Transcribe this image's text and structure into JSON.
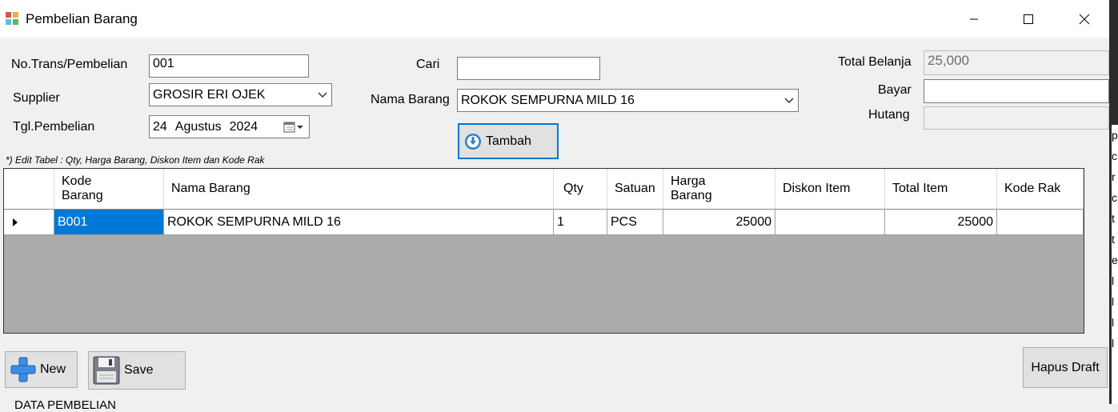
{
  "window": {
    "title": "Pembelian Barang"
  },
  "form": {
    "no_trans_label": "No.Trans/Pembelian",
    "no_trans_value": "001",
    "supplier_label": "Supplier",
    "supplier_value": "GROSIR ERI OJEK",
    "tgl_label": "Tgl.Pembelian",
    "tgl_day": "24",
    "tgl_month": "Agustus",
    "tgl_year": "2024",
    "cari_label": "Cari",
    "cari_value": "",
    "nama_barang_label": "Nama Barang",
    "nama_barang_value": "ROKOK SEMPURNA MILD 16",
    "tambah_label": "Tambah",
    "total_belanja_label": "Total Belanja",
    "total_belanja_value": "25,000",
    "bayar_label": "Bayar",
    "bayar_value": "",
    "hutang_label": "Hutang",
    "hutang_value": "",
    "note": "*) Edit Tabel : Qty, Harga Barang, Diskon Item dan Kode Rak"
  },
  "grid": {
    "headers": {
      "kode_barang": "Kode\nBarang",
      "nama_barang": "Nama Barang",
      "qty": "Qty",
      "satuan": "Satuan",
      "harga_barang": "Harga\nBarang",
      "diskon_item": "Diskon Item",
      "total_item": "Total Item",
      "kode_rak": "Kode Rak"
    },
    "rows": [
      {
        "kode_barang": "B001",
        "nama_barang": "ROKOK SEMPURNA MILD 16",
        "qty": "1",
        "satuan": "PCS",
        "harga_barang": "25000",
        "diskon_item": "",
        "total_item": "25000",
        "kode_rak": ""
      }
    ]
  },
  "buttons": {
    "new_label": "New",
    "save_label": "Save",
    "hapus_draft_label": "Hapus Draft"
  },
  "footer": {
    "section_label": "DATA PEMBELIAN"
  },
  "background_window": {
    "visible_text": [
      "p",
      "c",
      "r",
      "c",
      "t",
      "t",
      "e",
      "l",
      "l",
      "l",
      "l"
    ]
  },
  "colors": {
    "accent": "#0078d7",
    "grid_bg": "#ababab"
  },
  "icons": [
    "app-icon",
    "minimize-icon",
    "maximize-icon",
    "close-icon",
    "chevron-down-icon",
    "calendar-icon",
    "down-arrow-circle-icon",
    "plus-icon",
    "floppy-disk-icon"
  ]
}
